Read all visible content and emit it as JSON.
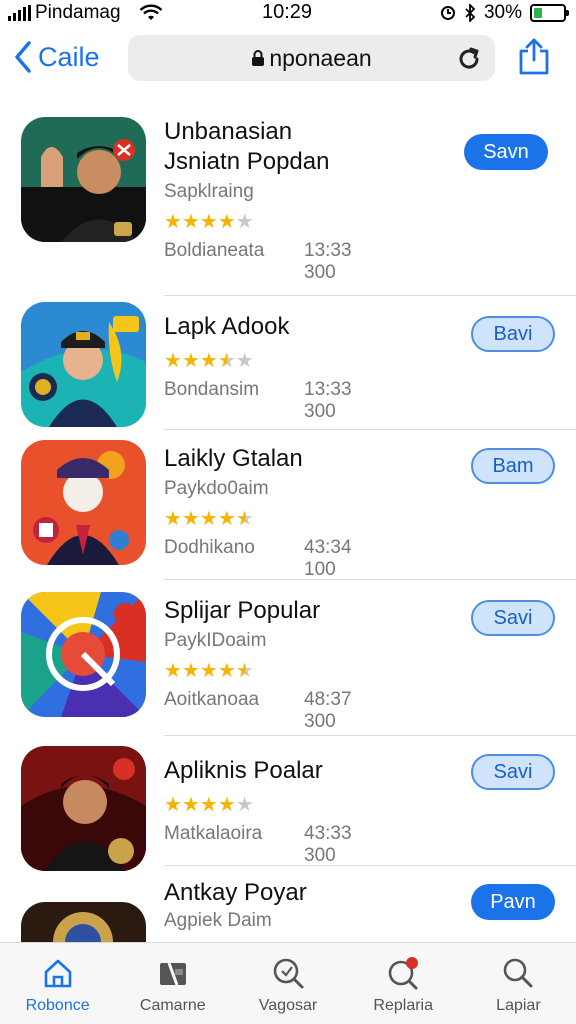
{
  "status_bar": {
    "carrier": "Pindamag",
    "time": "10:29",
    "battery_percent": "30%",
    "battery_level": 0.3
  },
  "nav": {
    "back_label": "Caile",
    "url": "nponaean"
  },
  "apps": [
    {
      "title_line1": "Unbanasian",
      "title_line2": "Jsniatn Popdan",
      "subtitle": "Sapklraing",
      "rating": 4,
      "meta_left": "Boldianeata",
      "meta_right": "13:33 300",
      "button_label": "Savn",
      "button_style": "solid",
      "icon": "portrait-icon-officer"
    },
    {
      "title_line1": "Lapk Adook",
      "title_line2": "",
      "subtitle": "",
      "rating": 3.5,
      "meta_left": "Bondansim",
      "meta_right": "13:33 300",
      "button_label": "Bavi",
      "button_style": "outline",
      "icon": "portrait-icon-cap"
    },
    {
      "title_line1": "Laikly Gtalan",
      "title_line2": "",
      "subtitle": "Paykdo0aim",
      "rating": 4.5,
      "meta_left": "Dodhikano",
      "meta_right": "43:34 100",
      "button_label": "Bam",
      "button_style": "outline",
      "icon": "portrait-icon-red"
    },
    {
      "title_line1": "Splijar Popular",
      "title_line2": "",
      "subtitle": "PaykIDoaim",
      "rating": 4.5,
      "meta_left": "Aoitkanoaa",
      "meta_right": "48:37 300",
      "button_label": "Savi",
      "button_style": "outline",
      "icon": "browser-icon"
    },
    {
      "title_line1": "Apliknis Poalar",
      "title_line2": "",
      "subtitle": "",
      "rating": 4,
      "meta_left": "Matkalaoira",
      "meta_right": "43:33 300",
      "button_label": "Savi",
      "button_style": "outline",
      "icon": "portrait-icon-dark"
    },
    {
      "title_line1": "Antkay Poyar",
      "title_line2": "",
      "subtitle": "Agpiek Daim",
      "rating": 0,
      "meta_left": "",
      "meta_right": "",
      "button_label": "Pavn",
      "button_style": "solid",
      "icon": "portrait-icon-gold"
    }
  ],
  "tabs": [
    {
      "label": "Robonce",
      "icon": "home-icon",
      "active": true
    },
    {
      "label": "Camarne",
      "icon": "games-icon",
      "active": false
    },
    {
      "label": "Vagosar",
      "icon": "search-badge-icon",
      "active": false
    },
    {
      "label": "Replaria",
      "icon": "updates-icon",
      "active": false
    },
    {
      "label": "Lapiar",
      "icon": "search-icon",
      "active": false
    }
  ],
  "colors": {
    "accent": "#1a73e8",
    "star": "#f4b400",
    "star_off": "#c8c8c8"
  }
}
